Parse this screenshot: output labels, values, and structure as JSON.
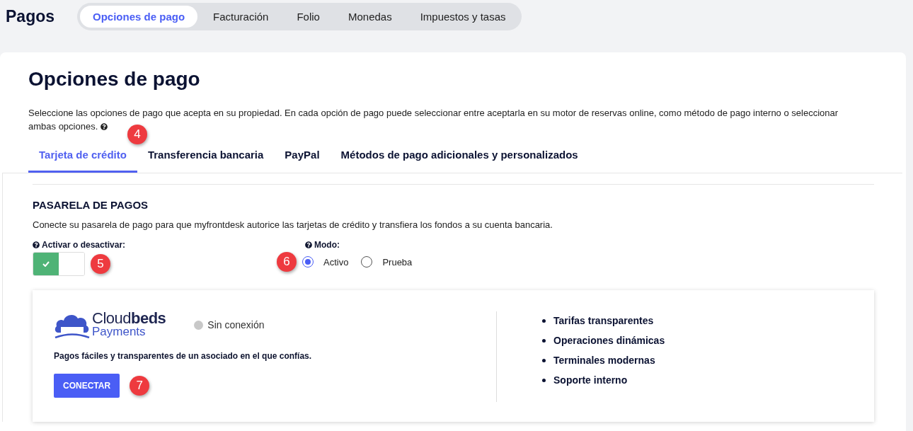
{
  "header": {
    "title": "Pagos",
    "nav": [
      {
        "label": "Opciones de pago",
        "selected": true
      },
      {
        "label": "Facturación",
        "selected": false
      },
      {
        "label": "Folio",
        "selected": false
      },
      {
        "label": "Monedas",
        "selected": false
      },
      {
        "label": "Impuestos y tasas",
        "selected": false
      }
    ]
  },
  "page": {
    "title": "Opciones de pago",
    "description_lines": [
      "Seleccione las opciones de pago que acepta en su propiedad. En cada opción de pago puede seleccionar entre aceptarla en su motor de reservas online, como método de pago interno o seleccionar",
      "ambas opciones."
    ]
  },
  "payment_tabs": [
    {
      "label": "Tarjeta de crédito",
      "selected": true,
      "callout": "4"
    },
    {
      "label": "Transferencia bancaria",
      "selected": false
    },
    {
      "label": "PayPal",
      "selected": false
    },
    {
      "label": "Métodos de pago adicionales y personalizados",
      "selected": false
    }
  ],
  "gateway": {
    "title": "PASARELA DE PAGOS",
    "description": "Conecte su pasarela de pago para que myfrontdesk autorice las tarjetas de crédito y transfiera los fondos a su cuenta bancaria.",
    "toggle": {
      "label": "Activar o desactivar:",
      "on": true,
      "callout": "5"
    },
    "mode": {
      "label": "Modo:",
      "callout": "6",
      "options": [
        {
          "label": "Activo",
          "selected": true
        },
        {
          "label": "Prueba",
          "selected": false
        }
      ]
    }
  },
  "provider": {
    "logo_name": "Cloud**beds**",
    "logo_sub": "Payments",
    "status": "Sin conexión",
    "connected": false,
    "tagline": "Pagos fáciles y transparentes de un asociado en el que confías.",
    "button": "CONECTAR",
    "callout": "7",
    "features": [
      "Tarifas transparentes",
      "Operaciones dinámicas",
      "Terminales modernas",
      "Soporte interno"
    ]
  }
}
